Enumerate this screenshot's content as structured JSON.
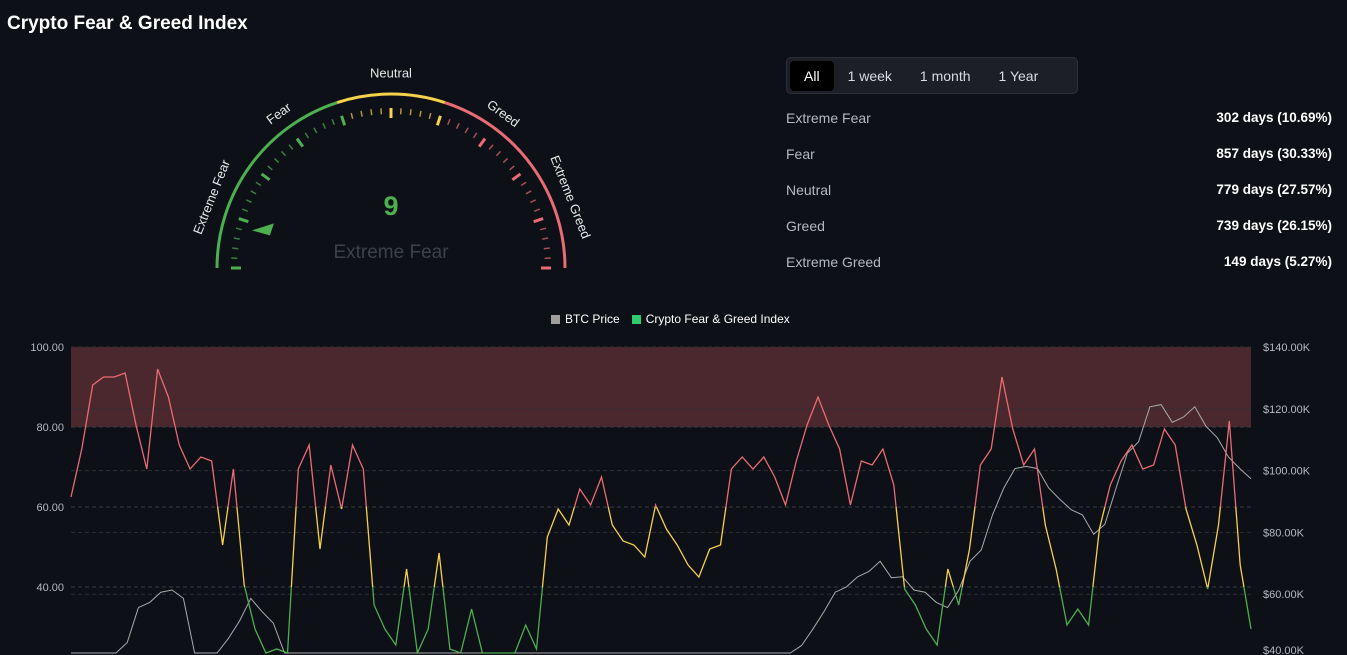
{
  "title": "Crypto Fear & Greed Index",
  "gauge": {
    "value": "9",
    "label": "Extreme Fear",
    "zones": [
      "Extreme Fear",
      "Fear",
      "Neutral",
      "Greed",
      "Extreme Greed"
    ],
    "value_number": 9
  },
  "tabs": [
    "All",
    "1 week",
    "1 month",
    "1 Year"
  ],
  "stats": [
    {
      "label": "Extreme Fear",
      "value": "302 days (10.69%)"
    },
    {
      "label": "Fear",
      "value": "857 days (30.33%)"
    },
    {
      "label": "Neutral",
      "value": "779 days (27.57%)"
    },
    {
      "label": "Greed",
      "value": "739 days (26.15%)"
    },
    {
      "label": "Extreme Greed",
      "value": "149 days (5.27%)"
    }
  ],
  "colors": {
    "green": "#4caf50",
    "yellow": "#f5d14e",
    "red": "#ea6b73",
    "gray": "#9e9e9e",
    "band": "#4a282e"
  },
  "chart_data": {
    "type": "line",
    "legend": [
      "BTC Price",
      "Crypto Fear & Greed Index"
    ],
    "left_ticks": [
      "100.00",
      "80.00",
      "60.00",
      "40.00"
    ],
    "right_ticks": [
      "$140.00K",
      "$120.00K",
      "$100.00K",
      "$80.00K",
      "$60.00K",
      "$40.00K"
    ],
    "ylim_left": [
      30,
      100
    ],
    "ylim_right": [
      40,
      140
    ],
    "fgi": [
      62,
      75,
      90,
      93,
      92,
      94,
      80,
      70,
      94,
      88,
      75,
      70,
      72,
      72,
      50,
      70,
      40,
      30,
      20,
      25,
      20,
      70,
      75,
      50,
      70,
      60,
      75,
      70,
      35,
      30,
      25,
      45,
      20,
      30,
      48,
      25,
      20,
      35,
      20,
      20,
      20,
      20,
      30,
      25,
      52,
      60,
      55,
      65,
      60,
      68,
      55,
      52,
      50,
      48,
      60,
      55,
      50,
      46,
      42,
      50,
      50,
      70,
      72,
      70,
      72,
      68,
      60,
      72,
      80,
      88,
      80,
      75,
      60,
      72,
      70,
      75,
      65,
      40,
      35,
      30,
      25,
      45,
      35,
      50,
      70,
      75,
      92,
      80,
      70,
      75,
      55,
      45,
      30,
      35,
      30,
      55,
      65,
      72,
      75,
      70,
      70,
      80,
      75,
      60,
      50,
      40,
      55,
      82,
      45,
      30
    ],
    "btc_k": [
      30,
      30,
      30,
      32,
      38,
      45,
      55,
      58,
      60,
      62,
      58,
      40,
      35,
      40,
      45,
      52,
      58,
      55,
      50,
      40,
      35,
      32,
      30,
      30,
      30,
      30,
      30,
      30,
      30,
      30,
      30,
      30,
      30,
      30,
      30,
      30,
      30,
      30,
      30,
      30,
      30,
      30,
      30,
      30,
      30,
      30,
      30,
      30,
      30,
      30,
      30,
      30,
      30,
      30,
      30,
      30,
      30,
      30,
      30,
      30,
      30,
      30,
      32,
      36,
      40,
      44,
      48,
      55,
      60,
      63,
      65,
      68,
      70,
      66,
      65,
      62,
      60,
      58,
      55,
      62,
      70,
      75,
      85,
      95,
      100,
      102,
      100,
      95,
      90,
      88,
      85,
      80,
      82,
      95,
      105,
      110,
      120,
      122,
      115,
      118,
      120,
      115,
      110,
      105,
      100,
      98
    ]
  }
}
